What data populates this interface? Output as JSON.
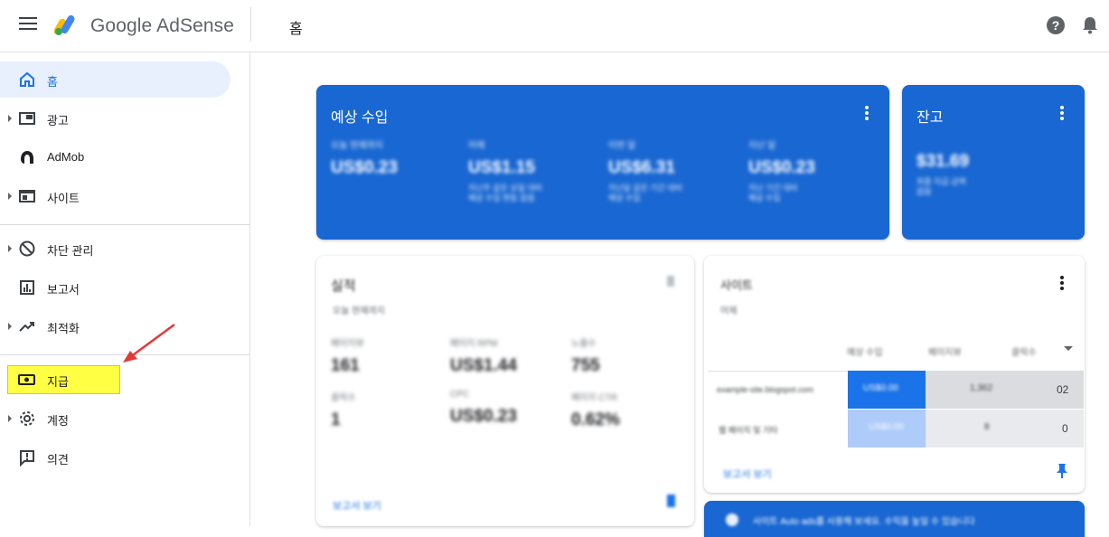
{
  "header": {
    "brand_prefix": "Google",
    "brand_name": "AdSense",
    "breadcrumb": "홈"
  },
  "sidebar": {
    "items": [
      {
        "label": "홈",
        "icon": "home-icon",
        "active": true
      },
      {
        "label": "광고",
        "icon": "ads-icon",
        "expandable": true
      },
      {
        "label": "AdMob",
        "icon": "admob-icon"
      },
      {
        "label": "사이트",
        "icon": "sites-icon",
        "expandable": true
      },
      {
        "label": "차단 관리",
        "icon": "block-icon",
        "expandable": true
      },
      {
        "label": "보고서",
        "icon": "reports-icon"
      },
      {
        "label": "최적화",
        "icon": "trending-up-icon",
        "expandable": true
      },
      {
        "label": "지급",
        "icon": "payments-icon",
        "highlighted": true
      },
      {
        "label": "계정",
        "icon": "gear-icon",
        "expandable": true
      },
      {
        "label": "의견",
        "icon": "feedback-icon"
      }
    ]
  },
  "earnings_card": {
    "title": "예상 수입",
    "metrics": [
      {
        "label": "오늘 현재까지",
        "value": "US$0.23",
        "sub": ""
      },
      {
        "label": "어제",
        "value": "US$1.15",
        "sub": "지난주 같은 요일 대비\n예상 수입 변동 없음"
      },
      {
        "label": "이번 달",
        "value": "US$6.31",
        "sub": "지난달 같은 기간 대비\n예상 수입"
      },
      {
        "label": "지난 달",
        "value": "US$0.23",
        "sub": "지난 기간 대비\n예상 수입"
      }
    ]
  },
  "balance_card": {
    "title": "잔고",
    "value": "$31.69",
    "sub": "최종 지급 금액\n없음"
  },
  "performance_card": {
    "title": "실적",
    "subtitle": "오늘 현재까지",
    "metrics": [
      {
        "label": "페이지뷰",
        "value": "161"
      },
      {
        "label": "페이지 RPM",
        "value": "US$1.44"
      },
      {
        "label": "노출수",
        "value": "755"
      },
      {
        "label": "클릭수",
        "value": "1"
      },
      {
        "label": "CPC",
        "value": "US$0.23"
      },
      {
        "label": "페이지 CTR",
        "value": "0.62%"
      }
    ],
    "footer_link": "보고서 보기"
  },
  "sites_card": {
    "title": "사이트",
    "subtitle": "어제",
    "columns": [
      "예상 수입",
      "페이지뷰",
      "클릭수"
    ],
    "rows": [
      {
        "site": "example-site.blogspot.com",
        "earnings": "US$0.00",
        "pageviews": "1,362",
        "clicks": "02"
      },
      {
        "site": "웹 페이지 및 기타",
        "earnings": "US$0.00",
        "pageviews": "8",
        "clicks": "0"
      }
    ],
    "footer_link": "보고서 보기"
  },
  "notice_card": {
    "text": "사이트 Auto ads를 사용해 보세요. 수익을 높일 수 있습니다"
  },
  "colors": {
    "brand_blue": "#1967d2",
    "active_bg": "#e8f0fe",
    "highlight": "#ffff44",
    "arrow_red": "#e53935"
  }
}
